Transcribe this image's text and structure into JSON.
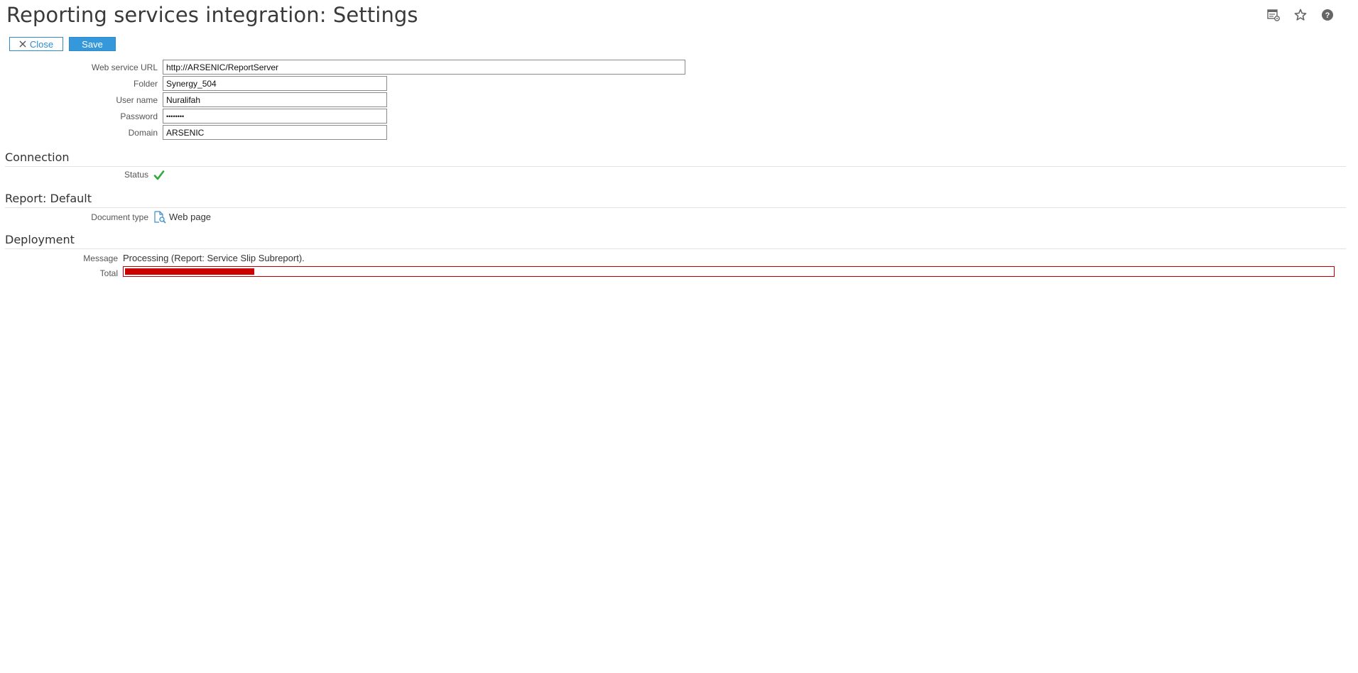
{
  "page": {
    "title": "Reporting services integration: Settings"
  },
  "top_icons": [
    "settings-page-icon",
    "star-icon",
    "help-icon"
  ],
  "toolbar": {
    "close_label": "Close",
    "save_label": "Save"
  },
  "form": {
    "web_service_url": {
      "label": "Web service URL",
      "value": "http://ARSENIC/ReportServer"
    },
    "folder": {
      "label": "Folder",
      "value": "Synergy_504"
    },
    "user_name": {
      "label": "User name",
      "value": "Nuralifah"
    },
    "password": {
      "label": "Password",
      "value": "••••••••"
    },
    "domain": {
      "label": "Domain",
      "value": "ARSENIC"
    }
  },
  "connection": {
    "title": "Connection",
    "status_label": "Status",
    "status_icon": "check-icon"
  },
  "report": {
    "title": "Report: Default",
    "document_type_label": "Document type",
    "document_type_value": "Web page"
  },
  "deployment": {
    "title": "Deployment",
    "message_label": "Message",
    "message_value": "Processing (Report: Service Slip Subreport).",
    "total_label": "Total",
    "total_progress": 0.107
  },
  "colors": {
    "accent": "#3498db",
    "progress": "#cc0000",
    "check": "#2eaa3c"
  }
}
